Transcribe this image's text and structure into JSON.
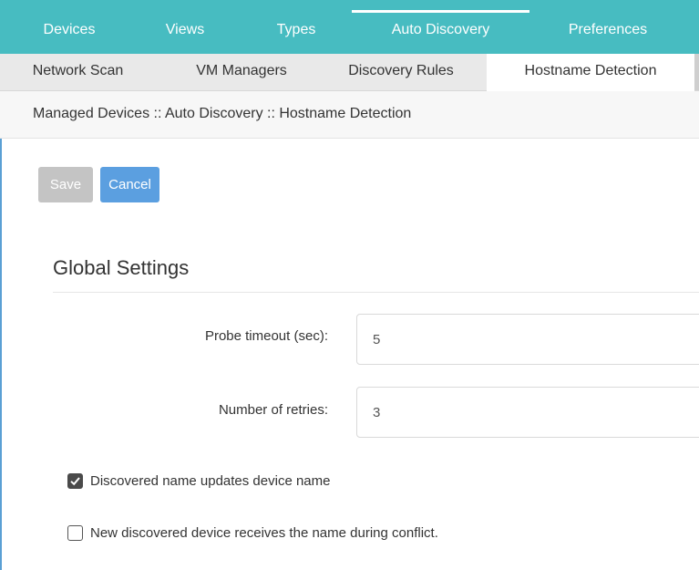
{
  "top_nav": {
    "tabs": [
      {
        "label": "Devices"
      },
      {
        "label": "Views"
      },
      {
        "label": "Types"
      },
      {
        "label": "Auto Discovery"
      },
      {
        "label": "Preferences"
      }
    ],
    "active": "Auto Discovery"
  },
  "sub_nav": {
    "tabs": [
      {
        "label": "Network Scan"
      },
      {
        "label": "VM Managers"
      },
      {
        "label": "Discovery Rules"
      },
      {
        "label": "Hostname Detection"
      }
    ],
    "active": "Hostname Detection"
  },
  "breadcrumb": "Managed Devices :: Auto Discovery :: Hostname Detection",
  "toolbar": {
    "save_label": "Save",
    "cancel_label": "Cancel"
  },
  "section": {
    "title": "Global Settings"
  },
  "fields": {
    "probe_timeout": {
      "label": "Probe timeout (sec):",
      "value": "5"
    },
    "retries": {
      "label": "Number of retries:",
      "value": "3"
    }
  },
  "checkboxes": {
    "updates_name": {
      "label": "Discovered name updates device name",
      "checked": true
    },
    "new_device_conflict": {
      "label": "New discovered device receives the name during conflict.",
      "checked": false
    }
  },
  "colors": {
    "nav_bg": "#47bcc1",
    "cancel_button": "#5b9fe0",
    "save_button_disabled": "#c4c4c4",
    "subnav_bg": "#e9e9e9"
  }
}
